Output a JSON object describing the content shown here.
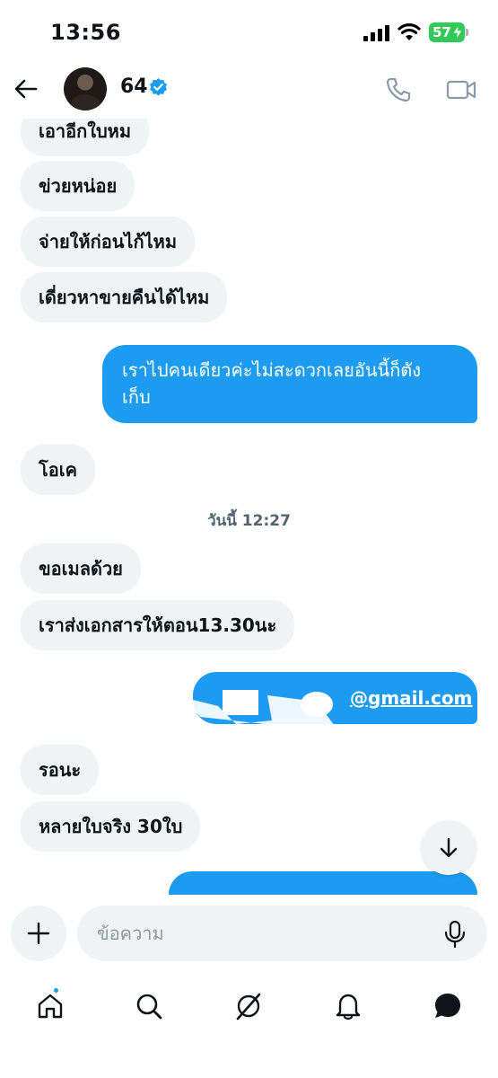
{
  "status": {
    "time": "13:56",
    "battery": "57"
  },
  "header": {
    "name": "64"
  },
  "messages": {
    "m1": "เอาอีกใบหม",
    "m2": "ข่วยหน่อย",
    "m3": "จ่ายให้ก่อนไก้ไหม",
    "m4": "เดี่ยวหาขายคืนได้ไหม",
    "m5_line1": "เราไปคนเดียวค่ะไม่สะดวกเลยอันนี้ก็ตัง",
    "m5_line2": "เก็บ",
    "m6": "โอเค",
    "m7": "ขอเมลด้วย",
    "m8": "เราส่งเอกสารให้ตอน13.30นะ",
    "m9": "@gmail.com",
    "m10": "รอนะ",
    "m11": "หลายใบจริง 30ใบ"
  },
  "timestamp": "วันนี้ 12:27",
  "composer": {
    "placeholder": "ข้อความ"
  },
  "icons": {
    "back": "arrow-left-icon",
    "verified": "verified-badge-icon",
    "call": "phone-icon",
    "video": "video-camera-icon",
    "scroll": "arrow-down-icon",
    "add": "plus-icon",
    "mic": "microphone-icon",
    "home": "home-icon",
    "search": "search-icon",
    "grok": "grok-icon",
    "notifications": "bell-icon",
    "messages": "message-bubble-icon"
  },
  "colors": {
    "accent": "#1d9bf0",
    "incoming_bubble": "#eff3f4",
    "battery": "#34c759"
  }
}
